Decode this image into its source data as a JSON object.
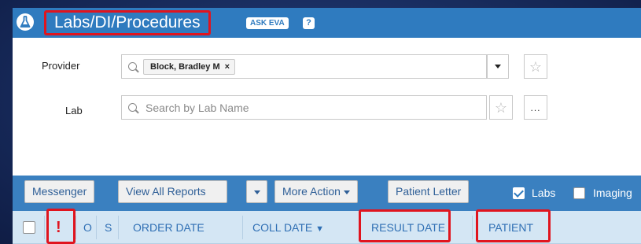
{
  "header": {
    "title": "Labs/DI/Procedures",
    "ask_eva": "ASK EVA",
    "help": "?"
  },
  "form": {
    "provider": {
      "label": "Provider",
      "selected_tag": "Block, Bradley M",
      "remove_glyph": "×"
    },
    "lab": {
      "label": "Lab",
      "placeholder": "Search by Lab Name",
      "more_glyph": "..."
    },
    "star_glyph": "☆"
  },
  "toolbar": {
    "messenger": "Messenger",
    "view_all_reports": "View All Reports",
    "more_action": "More Action",
    "patient_letter": "Patient Letter",
    "labs_label": "Labs",
    "labs_checked": true,
    "imaging_label": "Imaging",
    "imaging_checked": false
  },
  "table": {
    "headers": {
      "flag": "!",
      "o": "O",
      "s": "S",
      "order_date": "ORDER DATE",
      "coll_date": "COLL DATE",
      "sort_glyph": "▼",
      "result_date": "RESULT DATE",
      "patient": "PATIENT"
    }
  },
  "colors": {
    "header_blue": "#2f7bbf",
    "toolbar_blue": "#3a80c0",
    "highlight_red": "#e0141e",
    "column_header_bg": "#d4e6f4"
  }
}
